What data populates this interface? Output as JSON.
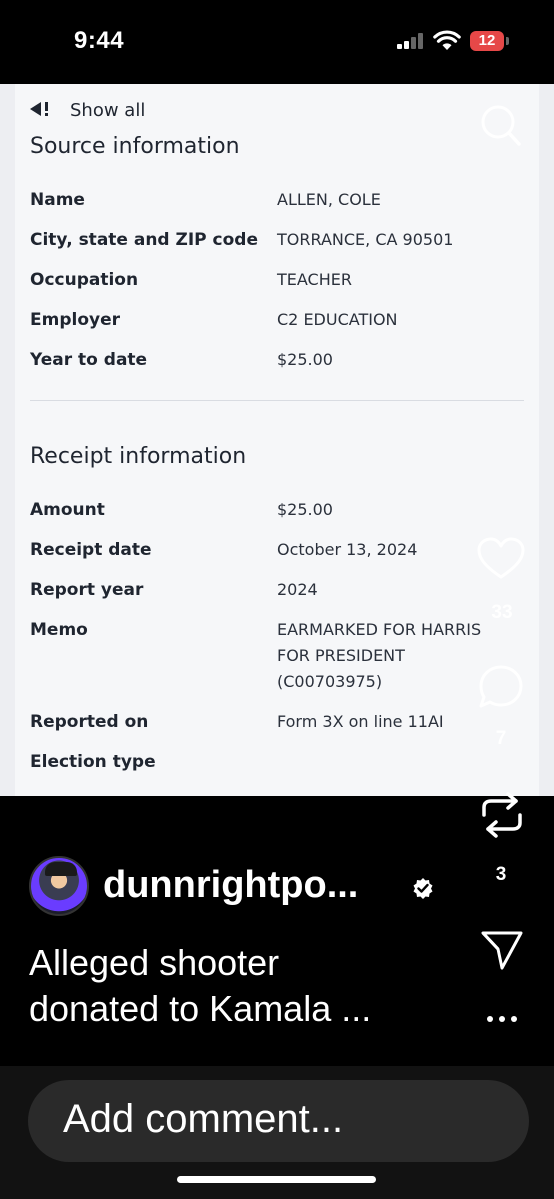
{
  "status_bar": {
    "time": "9:44",
    "battery": "12"
  },
  "document": {
    "show_all": "Show all",
    "source": {
      "title": "Source information",
      "rows": [
        {
          "label": "Name",
          "value": "ALLEN, COLE"
        },
        {
          "label": "City, state and ZIP code",
          "value": "TORRANCE, CA 90501"
        },
        {
          "label": "Occupation",
          "value": "TEACHER"
        },
        {
          "label": "Employer",
          "value": "C2 EDUCATION"
        },
        {
          "label": "Year to date",
          "value": "$25.00"
        }
      ]
    },
    "receipt": {
      "title": "Receipt information",
      "rows": [
        {
          "label": "Amount",
          "value": "$25.00"
        },
        {
          "label": "Receipt date",
          "value": "October 13, 2024"
        },
        {
          "label": "Report year",
          "value": "2024"
        },
        {
          "label": "Memo",
          "value_lines": [
            "EARMARKED FOR HARRIS",
            "FOR PRESIDENT",
            "(C00703975)"
          ]
        },
        {
          "label": "Reported on",
          "value": "Form 3X on line 11AI"
        },
        {
          "label": "Election type",
          "value": ""
        }
      ]
    }
  },
  "actions": {
    "likes": "33",
    "comments": "7",
    "reposts": "3"
  },
  "post": {
    "username": "dunnrightpo...",
    "caption_line1": "Alleged shooter",
    "caption_line2": "donated to Kamala ..."
  },
  "comment_bar": {
    "placeholder": "Add comment..."
  }
}
